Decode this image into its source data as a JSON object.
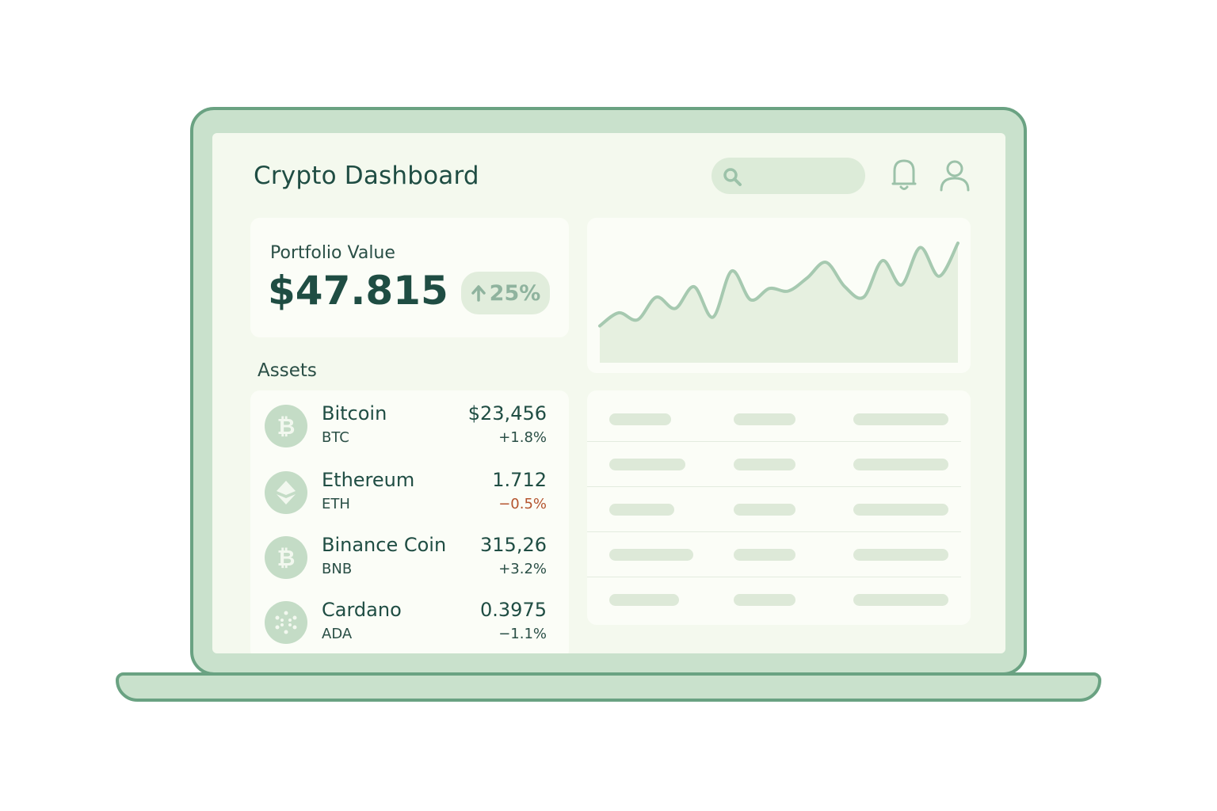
{
  "app": {
    "title": "Crypto Dashboard"
  },
  "header": {
    "search_placeholder": "",
    "icons": [
      "search-icon",
      "bell-icon",
      "user-icon"
    ]
  },
  "portfolio": {
    "label": "Portfolio Value",
    "value": "$47.815",
    "change": "25%",
    "change_direction": "up"
  },
  "assets": {
    "heading": "Assets",
    "items": [
      {
        "name": "Bitcoin",
        "symbol": "BTC",
        "price": "$23,456",
        "change": "+1.8%",
        "icon": "bitcoin-icon"
      },
      {
        "name": "Ethereum",
        "symbol": "ETH",
        "price": "1.712",
        "change": "−0.5%",
        "icon": "ethereum-icon"
      },
      {
        "name": "Binance Coin",
        "symbol": "BNB",
        "price": "315,26",
        "change": "+3.2%",
        "icon": "binance-icon"
      },
      {
        "name": "Cardano",
        "symbol": "ADA",
        "price": "0.3975",
        "change": "−1.1%",
        "icon": "cardano-icon"
      }
    ]
  },
  "colors": {
    "accent": "#6aa282",
    "text": "#1f4d43",
    "negative": "#b4542e",
    "fill": "#e6f0e0"
  },
  "chart_data": {
    "type": "area",
    "title": "",
    "xlabel": "",
    "ylabel": "",
    "grid": false,
    "values": [
      15,
      30,
      22,
      48,
      35,
      60,
      25,
      78,
      45,
      58,
      55,
      70,
      88,
      60,
      48,
      90,
      62,
      105,
      72,
      110
    ]
  }
}
